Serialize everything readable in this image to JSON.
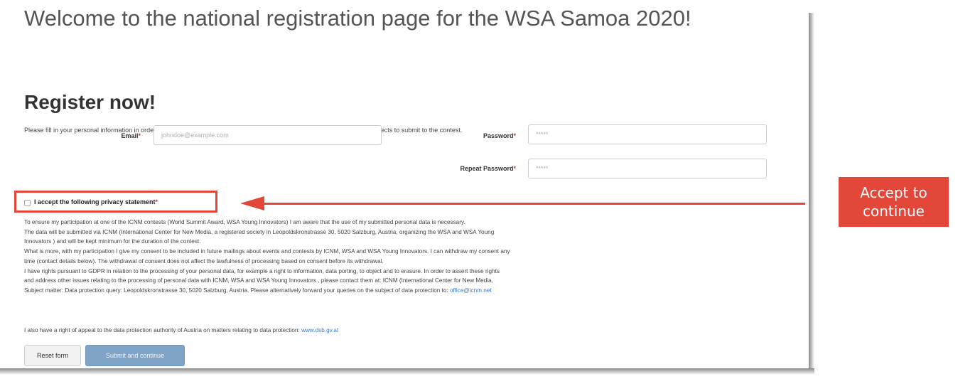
{
  "header": {
    "welcome": "Welcome to the national registration page for the WSA Samoa 2020!"
  },
  "register": {
    "title": "Register now!",
    "intro": "Please fill in your personal information in order to create a user account. Afterwords you will be able to sign in and register projects to submit to the contest."
  },
  "form": {
    "email_label": "Email",
    "email_placeholder": "johndoe@example.com",
    "password_label": "Password",
    "password_placeholder": "*****",
    "repeat_password_label": "Repeat Password",
    "repeat_password_placeholder": "*****",
    "required_marker": "*"
  },
  "privacy": {
    "checkbox_label": "I accept the following privacy statement",
    "required_marker": "*",
    "paragraphs": [
      "To ensure my participation at one of the ICNM contests (World Summit Award, WSA Young Innovators) I am aware that the use of my submitted personal data is necessary.",
      "The data will be submitted via ICNM (International Center for New Media, a registered society in Leopoldskronstrasse 30, 5020 Salzburg, Austria, organizing the WSA and WSA Young",
      "Innovators ) and will be kept minimum for the duration of the contest.",
      "What is more, with my participation I give my consent to be included in future mailings about events and contests by ICNM, WSA and WSA Young Innovators. I can withdraw my consent any",
      "time (contact details below). The withdrawal of consent does not affect the lawfulness of processing based on consent before its withdrawal.",
      "I have rights pursuant to GDPR in relation to the processing of your personal data, for example a right to information, data porting, to object and to erasure. In order to assert these rights",
      "and address other issues relating to the processing of personal data with ICNM, WSA and WSA Young Innovators , please contact them at: ICNM (International Center for New Media,"
    ],
    "last_line": "Subject matter: Data protection query: Leopoldskronstrasse 30, 5020 Salzburg, Austria. Please alternatively forward your queries on the subject of data protection to:",
    "email_link": "office@icnm.net",
    "appeal_text": "I also have a right of appeal to the data protection authority of Austria on matters relating to data protection:",
    "appeal_link": "www.dsb.gv.at"
  },
  "buttons": {
    "reset": "Reset form",
    "submit": "Submit and continue"
  },
  "annotation": {
    "callout_line1": "Accept to",
    "callout_line2": "continue",
    "color": "#e2473a"
  }
}
